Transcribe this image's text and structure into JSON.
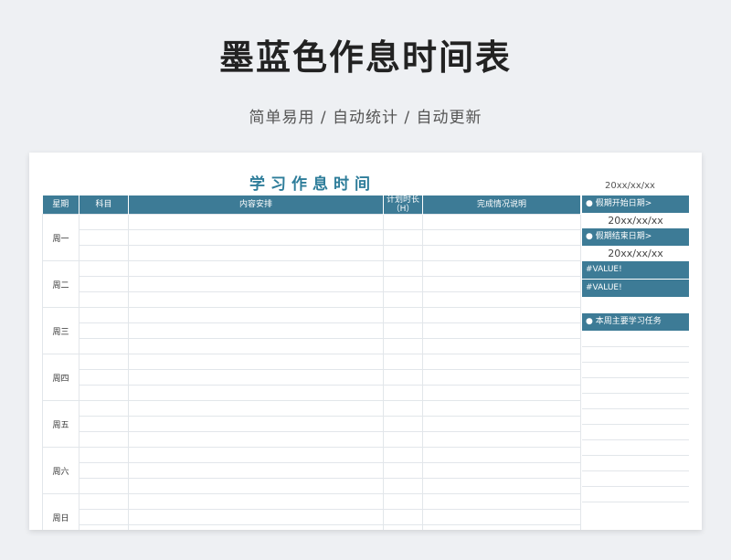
{
  "page": {
    "title": "墨蓝色作息时间表",
    "subtitle": "简单易用 / 自动统计 / 自动更新"
  },
  "sheet": {
    "title": "学习作息时间",
    "date": "20xx/xx/xx",
    "headers": {
      "weekday": "星期",
      "subject": "科目",
      "content": "内容安排",
      "plan_time": "计划时长\n（H）",
      "completion": "完成情况说明"
    },
    "days": [
      "周一",
      "周二",
      "周三",
      "周四",
      "周五",
      "周六",
      "周日"
    ]
  },
  "side": {
    "start_label": "● 假期开始日期>",
    "start_value": "20xx/xx/xx",
    "end_label": "● 假期结束日期>",
    "end_value": "20xx/xx/xx",
    "value1": "#VALUE!",
    "value2": "#VALUE!",
    "tasks_label": "● 本周主要学习任务"
  },
  "colors": {
    "accent": "#3d7b96",
    "title_color": "#2e7d9a"
  }
}
